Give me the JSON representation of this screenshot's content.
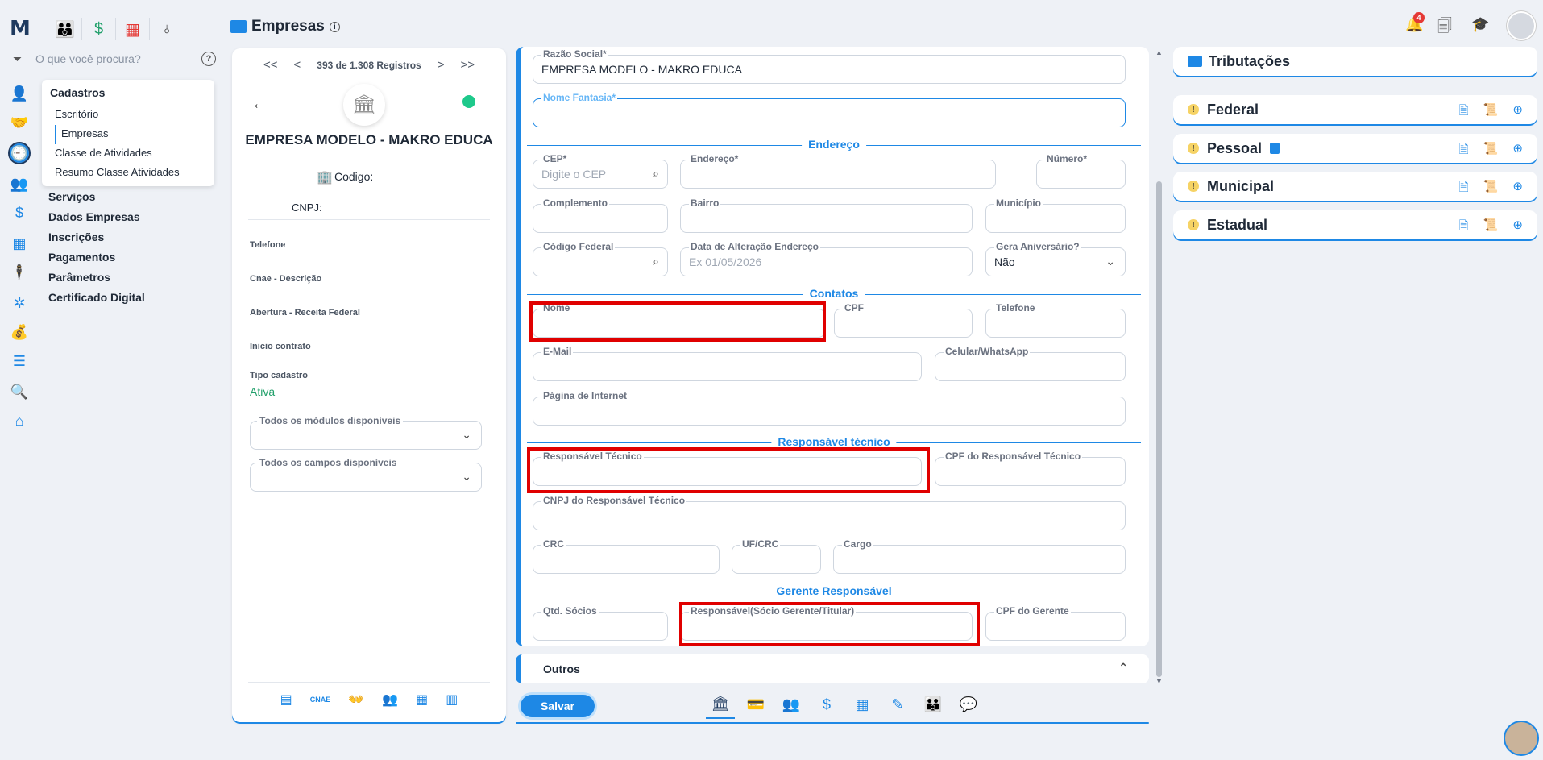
{
  "page": {
    "title": "Empresas"
  },
  "search": {
    "placeholder": "O que você procura?"
  },
  "menu": {
    "section": "Cadastros",
    "sub_items": [
      "Escritório",
      "Empresas",
      "Classe de Atividades",
      "Resumo Classe Atividades"
    ],
    "items": [
      "Serviços",
      "Dados Empresas",
      "Inscrições",
      "Pagamentos",
      "Parâmetros",
      "Certificado Digital"
    ]
  },
  "record": {
    "pager_text": "393 de 1.308 Registros",
    "nav": {
      "first": "<<",
      "prev": "<",
      "next": ">",
      "last": ">>"
    },
    "company_name": "EMPRESA MODELO - MAKRO EDUCA",
    "codigo_label": "Codigo:",
    "cnpj_label": "CNPJ:",
    "fields": [
      "Telefone",
      "Cnae - Descrição",
      "Abertura - Receita Federal",
      "Inicio contrato",
      "Tipo cadastro"
    ],
    "tipo_value": "Ativa",
    "selects": [
      "Todos os módulos disponíveis",
      "Todos os campos disponíveis"
    ],
    "footer_cnae": "CNAE"
  },
  "form": {
    "razao_social": {
      "label": "Razão Social*",
      "value": "EMPRESA MODELO  - MAKRO EDUCA"
    },
    "nome_fantasia": {
      "label": "Nome Fantasia*",
      "value": ""
    },
    "sections": {
      "endereco": "Endereço",
      "contatos": "Contatos",
      "responsavel": "Responsável técnico",
      "gerente": "Gerente Responsável"
    },
    "cep": {
      "label": "CEP*",
      "placeholder": "Digite o CEP"
    },
    "endereco": {
      "label": "Endereço*"
    },
    "numero": {
      "label": "Número*"
    },
    "complemento": {
      "label": "Complemento"
    },
    "bairro": {
      "label": "Bairro"
    },
    "municipio": {
      "label": "Município"
    },
    "codigo_federal": {
      "label": "Código Federal"
    },
    "data_alteracao": {
      "label": "Data de Alteração Endereço",
      "placeholder": "Ex 01/05/2026"
    },
    "gera_aniversario": {
      "label": "Gera Aniversário?",
      "value": "Não"
    },
    "nome": {
      "label": "Nome"
    },
    "cpf": {
      "label": "CPF"
    },
    "telefone": {
      "label": "Telefone"
    },
    "email": {
      "label": "E-Mail"
    },
    "celular": {
      "label": "Celular/WhatsApp"
    },
    "pagina": {
      "label": "Página de Internet"
    },
    "resp_tecnico": {
      "label": "Responsável Técnico"
    },
    "cpf_resp": {
      "label": "CPF do Responsável Técnico"
    },
    "cnpj_resp": {
      "label": "CNPJ do Responsável Técnico"
    },
    "crc": {
      "label": "CRC"
    },
    "uf_crc": {
      "label": "UF/CRC"
    },
    "cargo": {
      "label": "Cargo"
    },
    "qtd_socios": {
      "label": "Qtd. Sócios"
    },
    "resp_socio": {
      "label": "Responsável(Sócio Gerente/Titular)"
    },
    "cpf_gerente": {
      "label": "CPF do Gerente"
    }
  },
  "outros": {
    "label": "Outros"
  },
  "save": {
    "label": "Salvar"
  },
  "tributacoes": {
    "title": "Tributações",
    "items": [
      "Federal",
      "Pessoal",
      "Municipal",
      "Estadual"
    ]
  },
  "notifications": {
    "count": "4"
  },
  "colors": {
    "accent": "#1e88e5",
    "highlight": "#e00000",
    "status_active": "#22a06b"
  }
}
